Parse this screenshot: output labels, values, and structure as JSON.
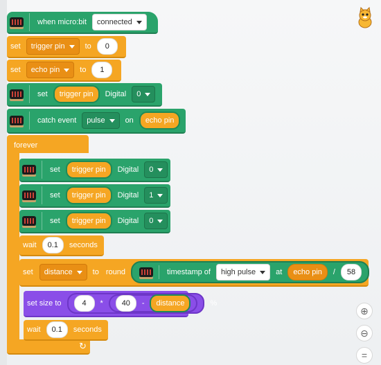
{
  "hat": {
    "label": "when micro:bit",
    "dropdown": "connected"
  },
  "set_trigger": {
    "set": "set",
    "var": "trigger pin",
    "to": "to",
    "value": "0"
  },
  "set_echo": {
    "set": "set",
    "var": "echo pin",
    "to": "to",
    "value": "1"
  },
  "digital_setup": {
    "set": "set",
    "pin": "trigger pin",
    "mode": "Digital",
    "value": "0"
  },
  "catch": {
    "label": "catch event",
    "event": "pulse",
    "on": "on",
    "pin": "echo pin"
  },
  "forever": {
    "label": "forever"
  },
  "digital_a": {
    "set": "set",
    "pin": "trigger pin",
    "mode": "Digital",
    "value": "0"
  },
  "digital_b": {
    "set": "set",
    "pin": "trigger pin",
    "mode": "Digital",
    "value": "1"
  },
  "digital_c": {
    "set": "set",
    "pin": "trigger pin",
    "mode": "Digital",
    "value": "0"
  },
  "wait_a": {
    "label": "wait",
    "value": "0.1",
    "unit": "seconds"
  },
  "set_distance": {
    "set": "set",
    "var": "distance",
    "to": "to",
    "round": "round",
    "timestamp": "timestamp of",
    "edge": "high pulse",
    "at": "at",
    "pin": "echo pin",
    "op": "/",
    "divisor": "58"
  },
  "set_size": {
    "label": "set size to",
    "a": "4",
    "op1": "*",
    "b": "40",
    "op2": "-",
    "var": "distance",
    "unit": "%"
  },
  "wait_b": {
    "label": "wait",
    "value": "0.1",
    "unit": "seconds"
  },
  "loop_arrow": "↻",
  "zoom": {
    "in": "⊕",
    "out": "⊖",
    "reset": "="
  }
}
